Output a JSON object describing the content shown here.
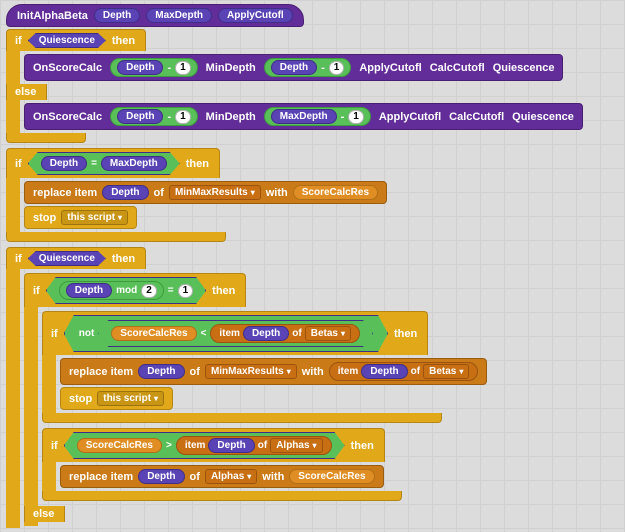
{
  "hat": {
    "name": "InitAlphaBeta",
    "p1": "Depth",
    "p2": "MaxDepth",
    "p3": "ApplyCutofl"
  },
  "vars": {
    "Quiescence": "Quiescence",
    "Depth": "Depth",
    "MaxDepth": "MaxDepth",
    "MinDepth": "MinDepth",
    "ApplyCutofl": "ApplyCutofl",
    "CalcCutofl": "CalcCutofl",
    "ScoreCalcRes": "ScoreCalcRes"
  },
  "lists": {
    "MinMaxResults": "MinMaxResults",
    "Betas": "Betas",
    "Alphas": "Alphas"
  },
  "nums": {
    "one": "1",
    "two": "2"
  },
  "calls": {
    "OnScoreCalc": "OnScoreCalc"
  },
  "kw": {
    "if": "if",
    "then": "then",
    "else": "else",
    "replace_item": "replace item",
    "of": "of",
    "with": "with",
    "stop": "stop",
    "this_script": "this script",
    "mod": "mod",
    "eq": "=",
    "lt": "<",
    "gt": ">",
    "item": "item",
    "not": "not",
    "minus": "-"
  }
}
